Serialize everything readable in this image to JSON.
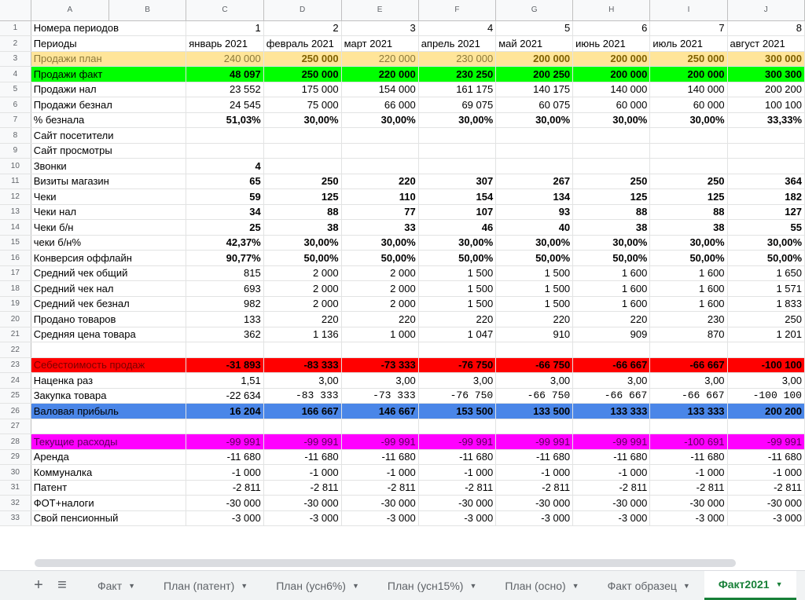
{
  "columns": [
    "A",
    "B",
    "C",
    "D",
    "E",
    "F",
    "G",
    "H",
    "I",
    "J"
  ],
  "rows": [
    {
      "n": "1",
      "label": "Номера периодов",
      "vals": [
        "1",
        "2",
        "3",
        "4",
        "5",
        "6",
        "7",
        "8"
      ]
    },
    {
      "n": "2",
      "label": "Периоды",
      "vals": [
        "январь 2021",
        "февраль 2021",
        "март 2021",
        "апрель 2021",
        "май 2021",
        "июнь 2021",
        "июль 2021",
        "август 2021"
      ]
    },
    {
      "n": "3",
      "label": "Продажи план",
      "vals": [
        "240 000",
        "250 000",
        "220 000",
        "230 000",
        "200 000",
        "200 000",
        "250 000",
        "300 000"
      ]
    },
    {
      "n": "4",
      "label": "Продажи факт",
      "vals": [
        "48 097",
        "250 000",
        "220 000",
        "230 250",
        "200 250",
        "200 000",
        "200 000",
        "300 300"
      ]
    },
    {
      "n": "5",
      "label": "Продажи нал",
      "vals": [
        "23 552",
        "175 000",
        "154 000",
        "161 175",
        "140 175",
        "140 000",
        "140 000",
        "200 200"
      ]
    },
    {
      "n": "6",
      "label": "Продажи безнал",
      "vals": [
        "24 545",
        "75 000",
        "66 000",
        "69 075",
        "60 075",
        "60 000",
        "60 000",
        "100 100"
      ]
    },
    {
      "n": "7",
      "label": "% безнала",
      "vals": [
        "51,03%",
        "30,00%",
        "30,00%",
        "30,00%",
        "30,00%",
        "30,00%",
        "30,00%",
        "33,33%"
      ]
    },
    {
      "n": "8",
      "label": "Сайт посетители",
      "vals": [
        "",
        "",
        "",
        "",
        "",
        "",
        "",
        ""
      ]
    },
    {
      "n": "9",
      "label": "Сайт просмотры",
      "vals": [
        "",
        "",
        "",
        "",
        "",
        "",
        "",
        ""
      ]
    },
    {
      "n": "10",
      "label": "Звонки",
      "vals": [
        "4",
        "",
        "",
        "",
        "",
        "",
        "",
        ""
      ]
    },
    {
      "n": "11",
      "label": "Визиты магазин",
      "vals": [
        "65",
        "250",
        "220",
        "307",
        "267",
        "250",
        "250",
        "364"
      ]
    },
    {
      "n": "12",
      "label": "Чеки",
      "vals": [
        "59",
        "125",
        "110",
        "154",
        "134",
        "125",
        "125",
        "182"
      ]
    },
    {
      "n": "13",
      "label": "Чеки нал",
      "vals": [
        "34",
        "88",
        "77",
        "107",
        "93",
        "88",
        "88",
        "127"
      ]
    },
    {
      "n": "14",
      "label": "Чеки б/н",
      "vals": [
        "25",
        "38",
        "33",
        "46",
        "40",
        "38",
        "38",
        "55"
      ]
    },
    {
      "n": "15",
      "label": "чеки б/н%",
      "vals": [
        "42,37%",
        "30,00%",
        "30,00%",
        "30,00%",
        "30,00%",
        "30,00%",
        "30,00%",
        "30,00%"
      ]
    },
    {
      "n": "16",
      "label": "Конверсия оффлайн",
      "vals": [
        "90,77%",
        "50,00%",
        "50,00%",
        "50,00%",
        "50,00%",
        "50,00%",
        "50,00%",
        "50,00%"
      ]
    },
    {
      "n": "17",
      "label": "Средний чек общий",
      "vals": [
        "815",
        "2 000",
        "2 000",
        "1 500",
        "1 500",
        "1 600",
        "1 600",
        "1 650"
      ]
    },
    {
      "n": "18",
      "label": "Средний чек нал",
      "vals": [
        "693",
        "2 000",
        "2 000",
        "1 500",
        "1 500",
        "1 600",
        "1 600",
        "1 571"
      ]
    },
    {
      "n": "19",
      "label": "Средний чек безнал",
      "vals": [
        "982",
        "2 000",
        "2 000",
        "1 500",
        "1 500",
        "1 600",
        "1 600",
        "1 833"
      ]
    },
    {
      "n": "20",
      "label": "Продано товаров",
      "vals": [
        "133",
        "220",
        "220",
        "220",
        "220",
        "220",
        "230",
        "250"
      ]
    },
    {
      "n": "21",
      "label": "Средняя цена товара",
      "vals": [
        "362",
        "1 136",
        "1 000",
        "1 047",
        "910",
        "909",
        "870",
        "1 201"
      ]
    },
    {
      "n": "22",
      "label": "",
      "vals": [
        "",
        "",
        "",
        "",
        "",
        "",
        "",
        ""
      ]
    },
    {
      "n": "23",
      "label": "Себестоимость продаж",
      "vals": [
        "-31 893",
        "-83 333",
        "-73 333",
        "-76 750",
        "-66 750",
        "-66 667",
        "-66 667",
        "-100 100"
      ]
    },
    {
      "n": "24",
      "label": "Наценка раз",
      "vals": [
        "1,51",
        "3,00",
        "3,00",
        "3,00",
        "3,00",
        "3,00",
        "3,00",
        "3,00"
      ]
    },
    {
      "n": "25",
      "label": "Закупка товара",
      "vals": [
        "-22 634",
        "-83 333",
        "-73 333",
        "-76 750",
        "-66 750",
        "-66 667",
        "-66 667",
        "-100 100"
      ]
    },
    {
      "n": "26",
      "label": "Валовая прибыль",
      "vals": [
        "16 204",
        "166 667",
        "146 667",
        "153 500",
        "133 500",
        "133 333",
        "133 333",
        "200 200"
      ]
    },
    {
      "n": "27",
      "label": "",
      "vals": [
        "",
        "",
        "",
        "",
        "",
        "",
        "",
        ""
      ]
    },
    {
      "n": "28",
      "label": "Текущие расходы",
      "vals": [
        "-99 991",
        "-99 991",
        "-99 991",
        "-99 991",
        "-99 991",
        "-99 991",
        "-100 691",
        "-99 991"
      ]
    },
    {
      "n": "29",
      "label": "Аренда",
      "vals": [
        "-11 680",
        "-11 680",
        "-11 680",
        "-11 680",
        "-11 680",
        "-11 680",
        "-11 680",
        "-11 680"
      ]
    },
    {
      "n": "30",
      "label": "Коммуналка",
      "vals": [
        "-1 000",
        "-1 000",
        "-1 000",
        "-1 000",
        "-1 000",
        "-1 000",
        "-1 000",
        "-1 000"
      ]
    },
    {
      "n": "31",
      "label": "Патент",
      "vals": [
        "-2 811",
        "-2 811",
        "-2 811",
        "-2 811",
        "-2 811",
        "-2 811",
        "-2 811",
        "-2 811"
      ]
    },
    {
      "n": "32",
      "label": "ФОТ+налоги",
      "vals": [
        "-30 000",
        "-30 000",
        "-30 000",
        "-30 000",
        "-30 000",
        "-30 000",
        "-30 000",
        "-30 000"
      ]
    },
    {
      "n": "33",
      "label": "Свой пенсионный",
      "vals": [
        "-3 000",
        "-3 000",
        "-3 000",
        "-3 000",
        "-3 000",
        "-3 000",
        "-3 000",
        "-3 000"
      ]
    }
  ],
  "tabs": [
    {
      "label": "Факт",
      "active": false
    },
    {
      "label": "План (патент)",
      "active": false
    },
    {
      "label": "План (усн6%)",
      "active": false
    },
    {
      "label": "План (усн15%)",
      "active": false
    },
    {
      "label": "План (осно)",
      "active": false
    },
    {
      "label": "Факт образец",
      "active": false
    },
    {
      "label": "Факт2021",
      "active": true
    }
  ],
  "toolbar": {
    "add_label": "+",
    "list_label": "≡"
  },
  "colors": {
    "plan": "#ffe599",
    "fact": "#00ff00",
    "cost": "#ff0000",
    "gross": "#4a86e8",
    "expenses": "#ff00ff",
    "active_tab": "#188038"
  }
}
